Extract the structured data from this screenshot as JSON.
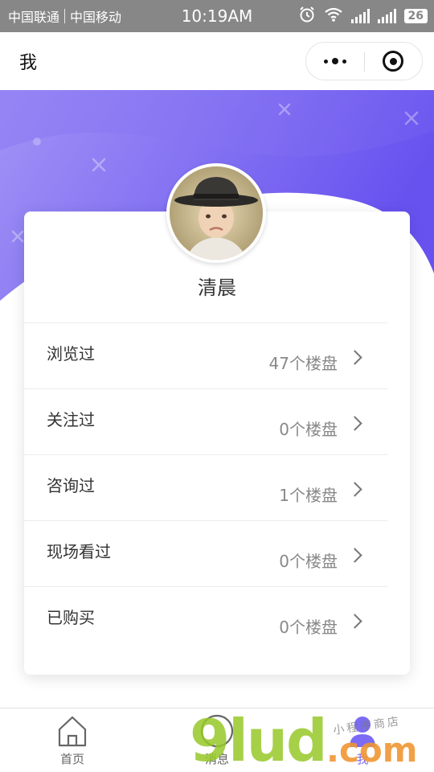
{
  "status_bar": {
    "carrier1": "中国联通",
    "carrier2": "中国移动",
    "time": "10:19AM",
    "battery": "26"
  },
  "nav": {
    "title": "我"
  },
  "profile": {
    "name": "清晨"
  },
  "records": [
    {
      "label": "浏览过",
      "value": "47个楼盘"
    },
    {
      "label": "关注过",
      "value": "0个楼盘"
    },
    {
      "label": "咨询过",
      "value": "1个楼盘"
    },
    {
      "label": "现场看过",
      "value": "0个楼盘"
    },
    {
      "label": "已购买",
      "value": "0个楼盘"
    }
  ],
  "tabs": [
    {
      "label": "首页",
      "icon": "home-icon"
    },
    {
      "label": "消息",
      "icon": "message-icon"
    },
    {
      "label": "我",
      "icon": "user-icon"
    }
  ],
  "watermark": {
    "brand": "9lud",
    "tld": ".com",
    "tagline": "小程序商店"
  },
  "colors": {
    "accent": "#7b6bf5",
    "hero_gradient_start": "#9d8cf5",
    "hero_gradient_end": "#6a56f0",
    "status_bar": "#878787"
  }
}
